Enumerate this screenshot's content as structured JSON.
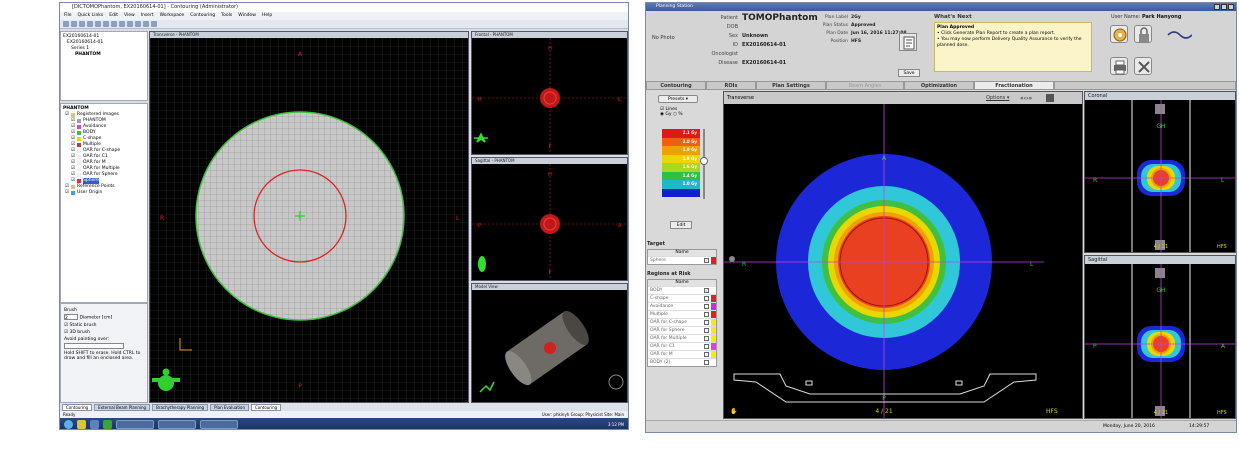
{
  "left": {
    "title": "[DICTOMOPhantom, EX20160614-01] - Contouring (Administrator)",
    "menu": [
      "File",
      "Quick Links",
      "Edit",
      "View",
      "Insert",
      "Workspace",
      "Contouring",
      "Tools",
      "Window",
      "Help"
    ],
    "tree": [
      "EX20160614-01",
      "EX20160614-01",
      "Series 1",
      "PHANTOM"
    ],
    "structures_header": "PHANTOM",
    "structures": [
      {
        "name": "Registered Images",
        "color": "#d8c080"
      },
      {
        "name": "PHANTOM",
        "color": "#a0a0a0"
      },
      {
        "name": "Avoidance",
        "color": "#e040e0"
      },
      {
        "name": "BODY",
        "color": "#40c040"
      },
      {
        "name": "C-shape",
        "color": "#e0e000"
      },
      {
        "name": "Multiple",
        "color": "#c04040"
      },
      {
        "name": "OAR for C-shape",
        "color": "#f0f0f0"
      },
      {
        "name": "OAR for C1",
        "color": "#f0f0f0"
      },
      {
        "name": "OAR for M",
        "color": "#f0f0f0"
      },
      {
        "name": "OAR for Multiple",
        "color": "#f0f0f0"
      },
      {
        "name": "OAR for Sphere",
        "color": "#f0f0f0"
      },
      {
        "name": "Sphere",
        "color": "#e03030"
      },
      {
        "name": "Reference Points",
        "color": "#d8c080"
      },
      {
        "name": "User Origin",
        "color": "#40a0e0"
      }
    ],
    "brush": {
      "title": "Brush",
      "diameter_label": "Diameter [cm]",
      "diameter_value": "2",
      "static_brush": "Static brush",
      "brush_3d": "3D brush",
      "avoid_painting": "Avoid painting over:",
      "hint": "Hold SHIFT to erase. Hold CTRL to draw and fill an enclosed area."
    },
    "panels": {
      "transverse": "Transverse - PHANTOM",
      "frontal": "Frontal - PHANTOM",
      "sagittal": "Sagittal - PHANTOM",
      "model": "Model View"
    },
    "orient": {
      "A": "A",
      "P": "P",
      "R": "R",
      "L": "L",
      "H": "H",
      "F": "F"
    },
    "tabs": [
      "Contouring",
      "External Beam Planning",
      "Brachytherapy Planning",
      "Plan Evaluation",
      "Contouring"
    ],
    "status_left": "Ready",
    "status_right": "User: phkinyh   Group: Physicist   Site: Main",
    "clock": "3:12 PM"
  },
  "right": {
    "title": "Planning Station",
    "no_photo": "No Photo",
    "patient": {
      "patient_label": "Patient",
      "patient_value": "TOMOPhantom",
      "dob_label": "DOB",
      "dob_value": "",
      "sex_label": "Sex",
      "sex_value": "Unknown",
      "id_label": "ID",
      "id_value": "EX20160614-01",
      "oncologist_label": "Oncologist",
      "oncologist_value": "",
      "disease_label": "Disease",
      "disease_value": "EX20160614-01"
    },
    "plan": {
      "label_label": "Plan Label",
      "label_value": "2Gy",
      "status_label": "Plan Status",
      "status_value": "Approved",
      "date_label": "Plan Date",
      "date_value": "Jun 16, 2016 11:27:08",
      "position_label": "Position",
      "position_value": "HFS"
    },
    "save": "Save",
    "whats_next": {
      "title": "What's Next",
      "heading": "Plan Approved",
      "line1": "Click Generate Plan Report to create a plan report.",
      "line2": "You may now perform Delivery Quality Assurance to verify the planned dose."
    },
    "user_label": "User Name:",
    "user_value": "Park Hanyong",
    "tabs": [
      "Contouring",
      "ROIs",
      "Plan Settings",
      "Beam Angles",
      "Optimization",
      "Fractionation"
    ],
    "presets": "Presets",
    "lines": "Lines",
    "gy": "Gy",
    "pct": "%",
    "dose_legend": [
      {
        "label": "2.1 Gy",
        "color": "#e01818"
      },
      {
        "label": "2.0 Gy",
        "color": "#f06010"
      },
      {
        "label": "1.9 Gy",
        "color": "#f0a000"
      },
      {
        "label": "1.8 Gy",
        "color": "#e8d800"
      },
      {
        "label": "1.6 Gy",
        "color": "#a8d820"
      },
      {
        "label": "1.4 Gy",
        "color": "#30c040"
      },
      {
        "label": "1.0 Gy",
        "color": "#20b8c8"
      },
      {
        "label": "",
        "color": "#1020d0"
      }
    ],
    "edit": "Edit",
    "target_title": "Target",
    "name_col": "Name",
    "targets": [
      {
        "name": "Sphere",
        "checked": true,
        "color": "#e02020"
      }
    ],
    "oar_title": "Regions at Risk",
    "oars": [
      {
        "name": "BODY",
        "checked": true,
        "color": "#ffffff"
      },
      {
        "name": "C-shape",
        "checked": false,
        "color": "#e02020"
      },
      {
        "name": "Avoidance",
        "checked": false,
        "color": "#e020e0"
      },
      {
        "name": "Multiple",
        "checked": false,
        "color": "#e02020"
      },
      {
        "name": "OAR for C-shape",
        "checked": false,
        "color": "#f0f000"
      },
      {
        "name": "OAR for Sphere",
        "checked": false,
        "color": "#f0f000"
      },
      {
        "name": "OAR for Multiple",
        "checked": false,
        "color": "#f0f000"
      },
      {
        "name": "OAR for C1",
        "checked": false,
        "color": "#e040e0"
      },
      {
        "name": "OAR for M",
        "checked": false,
        "color": "#f0f000"
      },
      {
        "name": "BODY (2)",
        "checked": false,
        "color": "#ffffff"
      }
    ],
    "transverse": "Transverse",
    "options": "Options",
    "coronal": "Coronal",
    "sagittal": "Sagittal",
    "orient": {
      "A": "A",
      "P": "P",
      "R": "R",
      "L": "L",
      "H": "GH",
      "HFS": "HFS"
    },
    "slice": "4 / 21",
    "date": "Monday, June 20, 2016",
    "time": "14:29:57"
  }
}
